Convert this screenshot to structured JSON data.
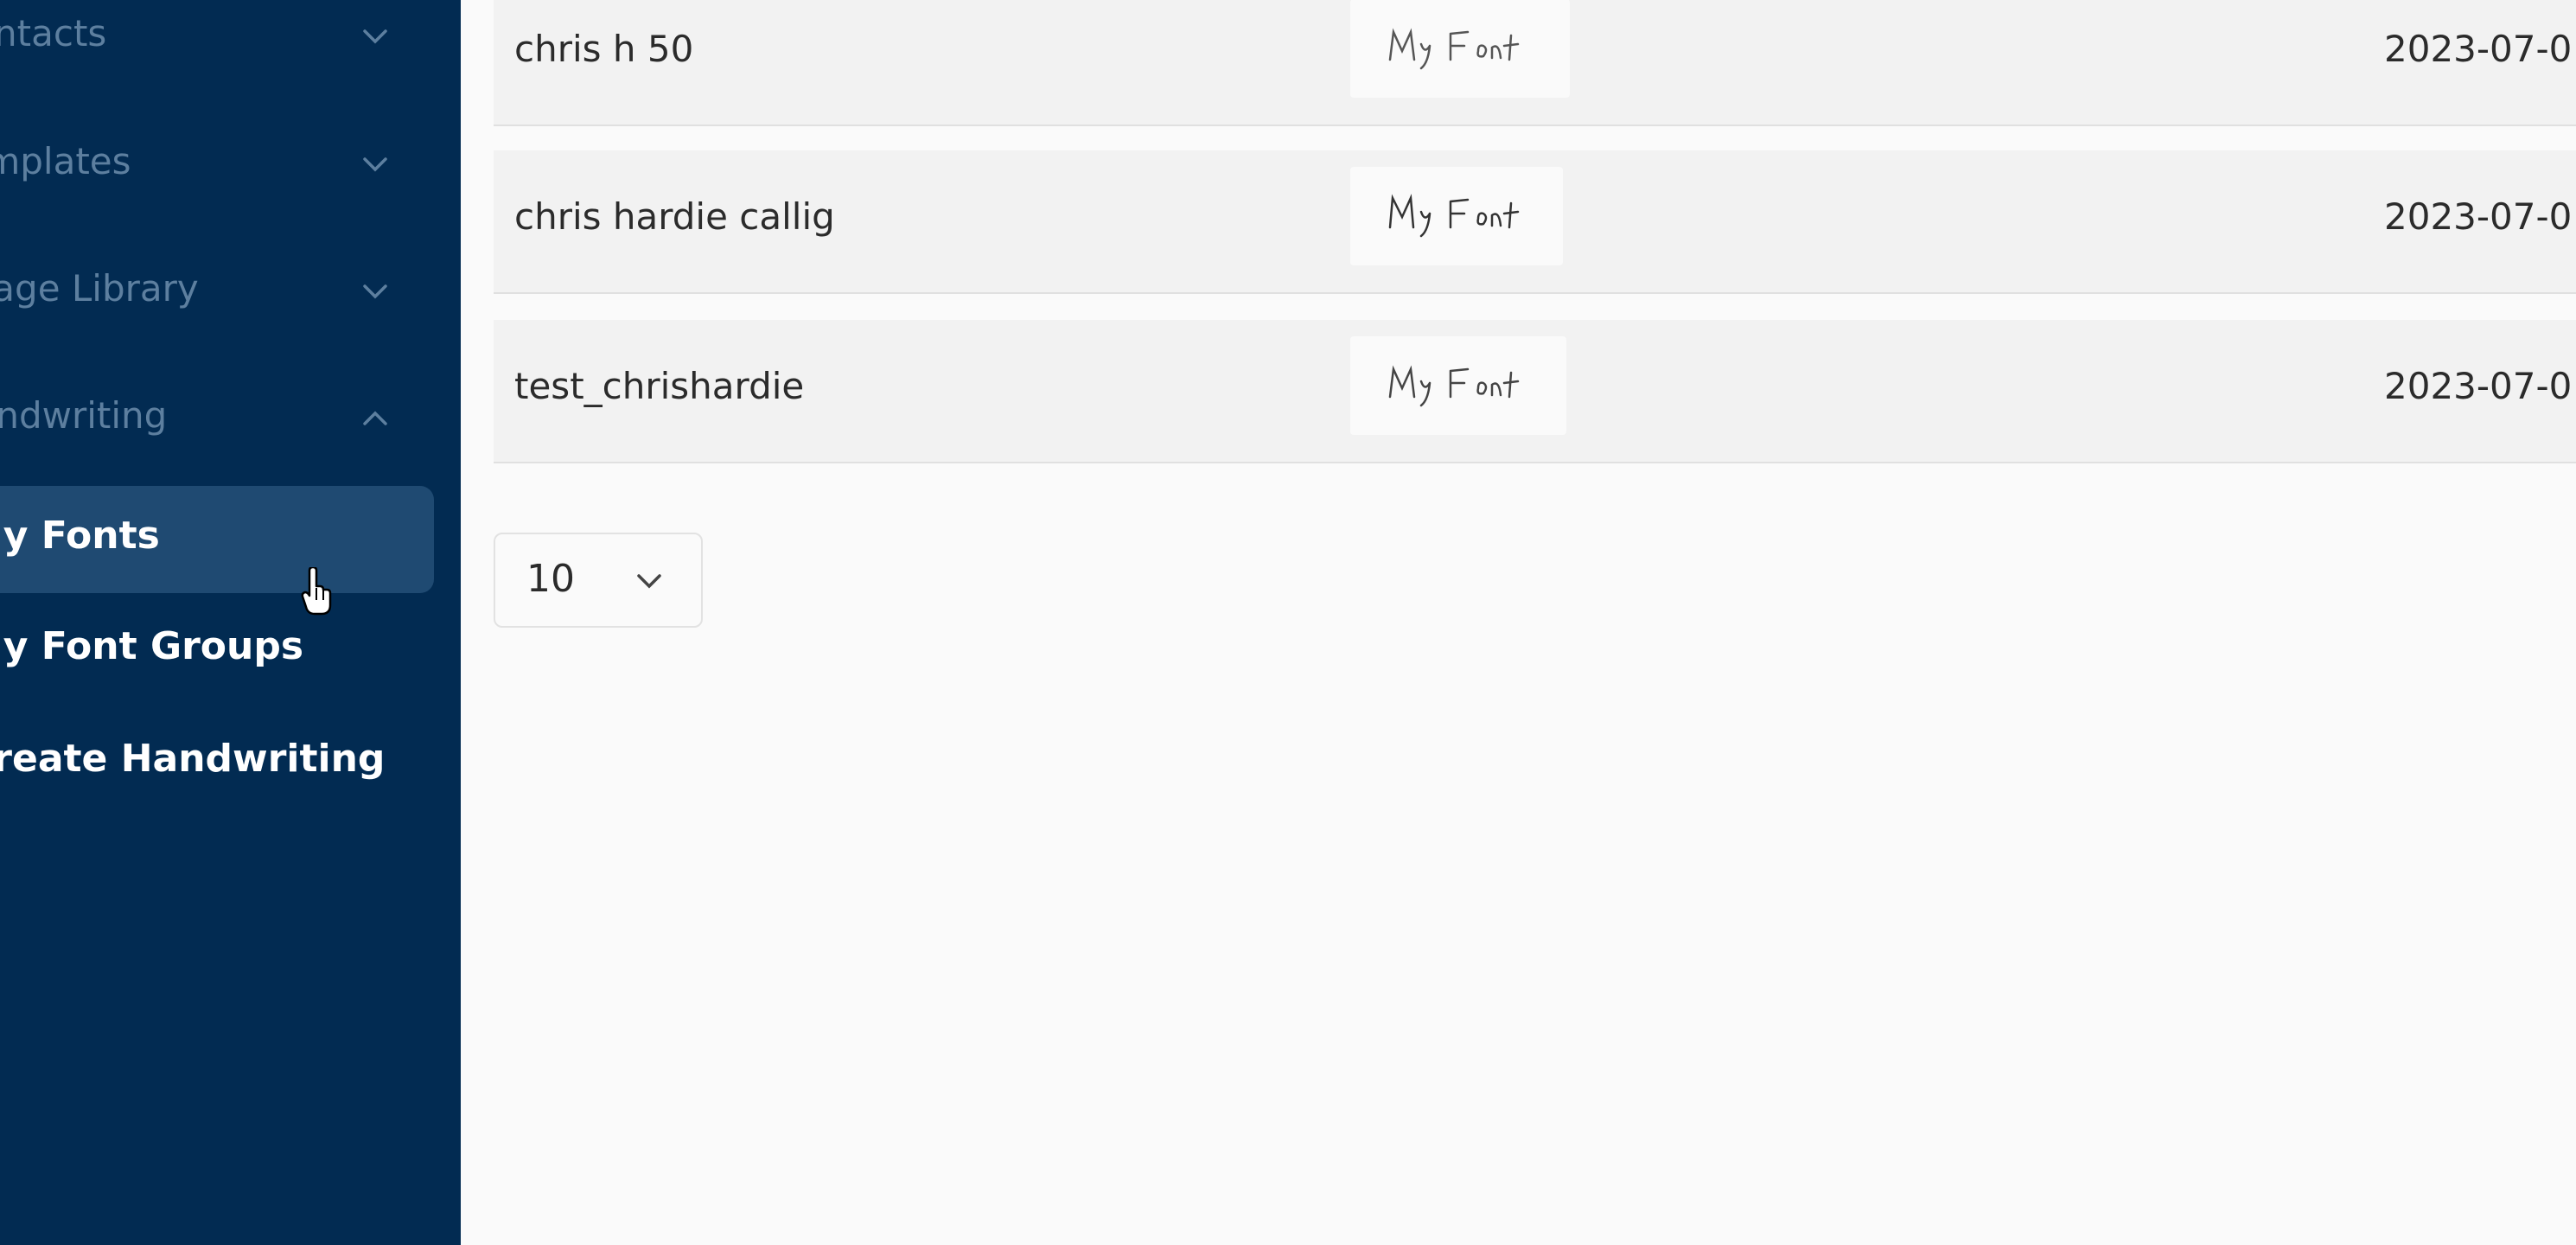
{
  "sidebar": {
    "sections": [
      {
        "label": "Contacts",
        "expanded": false
      },
      {
        "label": "Templates",
        "expanded": false
      },
      {
        "label": "Image Library",
        "expanded": false
      },
      {
        "label": "Handwriting",
        "expanded": true
      }
    ],
    "handwriting_items": [
      {
        "label": "My Fonts",
        "active": true
      },
      {
        "label": "My Font Groups",
        "active": false
      },
      {
        "label": "Create Handwriting",
        "active": false
      }
    ]
  },
  "fonts_table": {
    "rows": [
      {
        "name": "chris h 50",
        "preview": "My Font",
        "date": "2023-07-0"
      },
      {
        "name": "chris hardie callig",
        "preview": "My Font",
        "date": "2023-07-0"
      },
      {
        "name": "test_chrishardie",
        "preview": "My Font",
        "date": "2023-07-0"
      }
    ]
  },
  "pagination": {
    "page_size": "10"
  },
  "colors": {
    "sidebar_bg": "#022b52",
    "active_item_bg": "#1f4a72",
    "row_bg": "#f2f2f2"
  }
}
